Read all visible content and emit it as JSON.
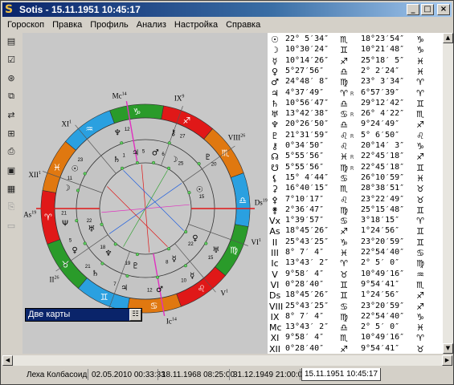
{
  "window": {
    "title": "Sotis - 15.11.1951 10:45:17",
    "app_icon": "sotis-s-icon",
    "controls": [
      "minimize",
      "maximize",
      "close"
    ]
  },
  "menu": [
    "Гороскоп",
    "Правка",
    "Профиль",
    "Анализ",
    "Настройка",
    "Справка"
  ],
  "toolbar": [
    "new-chart-icon",
    "edit-check-icon",
    "aspects-icon",
    "synastry-icon",
    "directions-icon",
    "transits-icon",
    "print-icon",
    "save-icon",
    "table-icon",
    "copy-icon",
    "paste-icon"
  ],
  "two_maps": {
    "label": "Две карты",
    "button": "list-icon"
  },
  "chart": {
    "zodiac_signs": [
      "♈",
      "♉",
      "♊",
      "♋",
      "♌",
      "♍",
      "♎",
      "♏",
      "♐",
      "♑",
      "♒",
      "♓"
    ],
    "ring_colors": [
      "#e01818",
      "#2a9b2a",
      "#2aa0e0",
      "#e07810"
    ],
    "house_labels": [
      "As",
      "II",
      "III",
      "Ic",
      "V",
      "VI",
      "Ds",
      "VIII",
      "IX",
      "Mc",
      "XI",
      "XII"
    ],
    "house_suffixes": [
      "19",
      "26",
      "9",
      "14",
      "1",
      "1",
      "19",
      "26",
      "9",
      "14",
      "1",
      "1"
    ],
    "outer_planets": [
      {
        "glyph": "☉",
        "deg": "23"
      },
      {
        "glyph": "☽",
        "deg": "11"
      },
      {
        "glyph": "Ψ",
        "deg": "21"
      },
      {
        "glyph": "♀",
        "deg": "5"
      },
      {
        "glyph": "♄",
        "deg": "21"
      },
      {
        "glyph": "♃",
        "deg": "7"
      },
      {
        "glyph": "♂",
        "deg": "12"
      },
      {
        "glyph": "☿",
        "deg": "10"
      },
      {
        "glyph": "♅",
        "deg": "15"
      },
      {
        "glyph": "♇",
        "deg": "20"
      },
      {
        "glyph": "⚷",
        "deg": "27"
      },
      {
        "glyph": "♆",
        "deg": "12"
      }
    ],
    "inner_planets": [
      {
        "glyph": "☽",
        "deg": "25"
      },
      {
        "glyph": "♂",
        "deg": "6"
      },
      {
        "glyph": "♃",
        "deg": "5"
      },
      {
        "glyph": "♄",
        "deg": "1"
      },
      {
        "glyph": "♅",
        "deg": "22"
      },
      {
        "glyph": "♆",
        "deg": "18"
      },
      {
        "glyph": "♇",
        "deg": "19"
      },
      {
        "glyph": "☿",
        "deg": "8"
      },
      {
        "glyph": "♀",
        "deg": "22"
      },
      {
        "glyph": "☉",
        "deg": "15"
      }
    ]
  },
  "table": [
    {
      "sym": "☉",
      "pos1": "22° 5′34″",
      "sign1": "♏",
      "flag": "",
      "pos2": "18°23′54″",
      "sign2": "♑"
    },
    {
      "sym": "☽",
      "pos1": "10°30′24″",
      "sign1": "♊",
      "flag": "",
      "pos2": "10°21′48″",
      "sign2": "♑"
    },
    {
      "sym": "☿",
      "pos1": "10°14′26″",
      "sign1": "♐",
      "flag": "",
      "pos2": "25°18′ 5″",
      "sign2": "♓"
    },
    {
      "sym": "♀",
      "pos1": " 5°27′56″",
      "sign1": "♎",
      "flag": "",
      "pos2": " 2° 2′24″",
      "sign2": "♓"
    },
    {
      "sym": "♂",
      "pos1": "24°48′ 8″",
      "sign1": "♍",
      "flag": "",
      "pos2": "23° 3′34″",
      "sign2": "♈"
    },
    {
      "sym": "♃",
      "pos1": " 4°37′49″",
      "sign1": "♈",
      "flag": "R",
      "pos2": " 6°57′39″",
      "sign2": "♈"
    },
    {
      "sym": "♄",
      "pos1": "10°56′47″",
      "sign1": "♎",
      "flag": "",
      "pos2": "29°12′42″",
      "sign2": "♊"
    },
    {
      "sym": "♅",
      "pos1": "13°42′38″",
      "sign1": "♋",
      "flag": "R",
      "pos2": "26° 4′22″",
      "sign2": "♏"
    },
    {
      "sym": "♆",
      "pos1": "20°26′50″",
      "sign1": "♎",
      "flag": "",
      "pos2": " 9°24′49″",
      "sign2": "♐"
    },
    {
      "sym": "♇",
      "pos1": "21°31′59″",
      "sign1": "♌",
      "flag": "R",
      "pos2": " 5° 6′50″",
      "sign2": "♌"
    },
    {
      "sym": "⚷",
      "pos1": " 0°34′50″",
      "sign1": "♌",
      "flag": "",
      "pos2": "20°14′ 3″",
      "sign2": "♑"
    },
    {
      "sym": "☊",
      "pos1": " 5°55′56″",
      "sign1": "♓",
      "flag": "R",
      "pos2": "22°45′18″",
      "sign2": "♐"
    },
    {
      "sym": "☋",
      "pos1": " 5°55′56″",
      "sign1": "♍",
      "flag": "R",
      "pos2": "22°45′18″",
      "sign2": "♊"
    },
    {
      "sym": "⚸",
      "pos1": "15° 4′44″",
      "sign1": "♋",
      "flag": "",
      "pos2": "26°10′59″",
      "sign2": "♓"
    },
    {
      "sym": "⚳",
      "pos1": "16°40′15″",
      "sign1": "♏",
      "flag": "",
      "pos2": "28°38′51″",
      "sign2": "♉"
    },
    {
      "sym": "⚴",
      "pos1": " 7°10′17″",
      "sign1": "♌",
      "flag": "",
      "pos2": "23°22′49″",
      "sign2": "♉"
    },
    {
      "sym": "⚵",
      "pos1": " 2°36′47″",
      "sign1": "♍",
      "flag": "",
      "pos2": "25°15′48″",
      "sign2": "♊"
    },
    {
      "sym": "Vx",
      "pos1": " 1°39′57″",
      "sign1": "♋",
      "flag": "",
      "pos2": " 3°18′15″",
      "sign2": "♈"
    },
    {
      "sym": "As",
      "pos1": "18°45′26″",
      "sign1": "♐",
      "flag": "",
      "pos2": " 1°24′56″",
      "sign2": "♊"
    },
    {
      "sym": "II",
      "pos1": "25°43′25″",
      "sign1": "♑",
      "flag": "",
      "pos2": "23°20′59″",
      "sign2": "♊"
    },
    {
      "sym": "III",
      "pos1": " 8° 7′ 4″",
      "sign1": "♓",
      "flag": "",
      "pos2": "22°54′40″",
      "sign2": "♋"
    },
    {
      "sym": "Ic",
      "pos1": "13°43′ 2″",
      "sign1": "♈",
      "flag": "",
      "pos2": " 2° 5′ 0″",
      "sign2": "♍"
    },
    {
      "sym": "V",
      "pos1": " 9°58′ 4″",
      "sign1": "♉",
      "flag": "",
      "pos2": "10°49′16″",
      "sign2": "♒"
    },
    {
      "sym": "VI",
      "pos1": " 0°28′40″",
      "sign1": "♊",
      "flag": "",
      "pos2": " 9°54′41″",
      "sign2": "♏"
    },
    {
      "sym": "Ds",
      "pos1": "18°45′26″",
      "sign1": "♊",
      "flag": "",
      "pos2": " 1°24′56″",
      "sign2": "♐"
    },
    {
      "sym": "VIII",
      "pos1": "25°43′25″",
      "sign1": "♋",
      "flag": "",
      "pos2": "23°20′59″",
      "sign2": "♐"
    },
    {
      "sym": "IX",
      "pos1": " 8° 7′ 4″",
      "sign1": "♍",
      "flag": "",
      "pos2": "22°54′40″",
      "sign2": "♑"
    },
    {
      "sym": "Mc",
      "pos1": "13°43′ 2″",
      "sign1": "♎",
      "flag": "",
      "pos2": " 2° 5′ 0″",
      "sign2": "♓"
    },
    {
      "sym": "XI",
      "pos1": " 9°58′ 4″",
      "sign1": "♏",
      "flag": "",
      "pos2": "10°49′16″",
      "sign2": "♈"
    },
    {
      "sym": "XII",
      "pos1": " 0°28′40″",
      "sign1": "♐",
      "flag": "",
      "pos2": " 9°54′41″",
      "sign2": "♉"
    }
  ],
  "tabs": [
    {
      "label": "Леха Колбасоид",
      "active": false
    },
    {
      "label": "02.05.2010 00:33:33",
      "active": false
    },
    {
      "label": "18.11.1968 08:25:00",
      "active": false
    },
    {
      "label": "31.12.1949 21:00:00",
      "active": false
    },
    {
      "label": "15.11.1951 10:45:17",
      "active": true
    }
  ]
}
